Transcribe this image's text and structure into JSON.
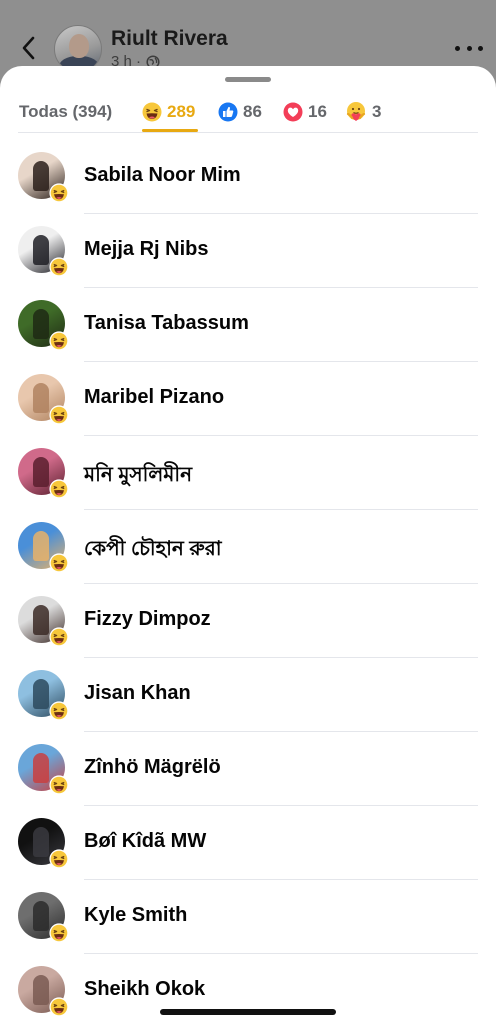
{
  "header": {
    "author_name": "Riult Rivera",
    "time": "3 h ·",
    "back_icon": "chevron-left-icon",
    "audience_icon": "globe-icon",
    "more_icon": "more-horizontal-icon"
  },
  "tabs": [
    {
      "label": "Todas (394)",
      "icon": "",
      "active": false
    },
    {
      "label": "289",
      "icon": "haha-reaction-icon",
      "active": true
    },
    {
      "label": "86",
      "icon": "like-reaction-icon",
      "active": false
    },
    {
      "label": "16",
      "icon": "love-reaction-icon",
      "active": false
    },
    {
      "label": "3",
      "icon": "care-reaction-icon",
      "active": false
    }
  ],
  "colors": {
    "accent": "#e8a912",
    "like_blue": "#1877f2",
    "love_red": "#f33e58"
  },
  "people": [
    {
      "name": "Sabila Noor Mim",
      "reaction": "haha-reaction-icon",
      "avatar_colors": [
        "#e7d6c9",
        "#2a1f1a"
      ]
    },
    {
      "name": "Mejja Rj Nibs",
      "reaction": "haha-reaction-icon",
      "avatar_colors": [
        "#efefef",
        "#1e1e24"
      ]
    },
    {
      "name": "Tanisa Tabassum",
      "reaction": "haha-reaction-icon",
      "avatar_colors": [
        "#3f6b28",
        "#1f2a14"
      ]
    },
    {
      "name": "Maribel Pizano",
      "reaction": "haha-reaction-icon",
      "avatar_colors": [
        "#e8c7ad",
        "#b08360"
      ]
    },
    {
      "name": "মনি মুসলিমীন",
      "reaction": "haha-reaction-icon",
      "avatar_colors": [
        "#d06a8a",
        "#5a1f2e"
      ]
    },
    {
      "name": "কেপী চৌহান রুরা",
      "reaction": "haha-reaction-icon",
      "avatar_colors": [
        "#4a8fd8",
        "#e6b26a"
      ]
    },
    {
      "name": "Fizzy Dimpoz",
      "reaction": "haha-reaction-icon",
      "avatar_colors": [
        "#dcdcdc",
        "#3b2a26"
      ]
    },
    {
      "name": "Jisan Khan",
      "reaction": "haha-reaction-icon",
      "avatar_colors": [
        "#8ebfe0",
        "#2d4a5e"
      ]
    },
    {
      "name": "Zînhö Mägrëlö",
      "reaction": "haha-reaction-icon",
      "avatar_colors": [
        "#6aa6d9",
        "#c94040"
      ]
    },
    {
      "name": "Bøî Kîdã MW",
      "reaction": "haha-reaction-icon",
      "avatar_colors": [
        "#111111",
        "#3a3a40"
      ]
    },
    {
      "name": "Kyle Smith",
      "reaction": "haha-reaction-icon",
      "avatar_colors": [
        "#6e6e6e",
        "#2c2c2c"
      ]
    },
    {
      "name": "Sheikh Okok",
      "reaction": "haha-reaction-icon",
      "avatar_colors": [
        "#c9a9a0",
        "#7a5a52"
      ]
    }
  ]
}
